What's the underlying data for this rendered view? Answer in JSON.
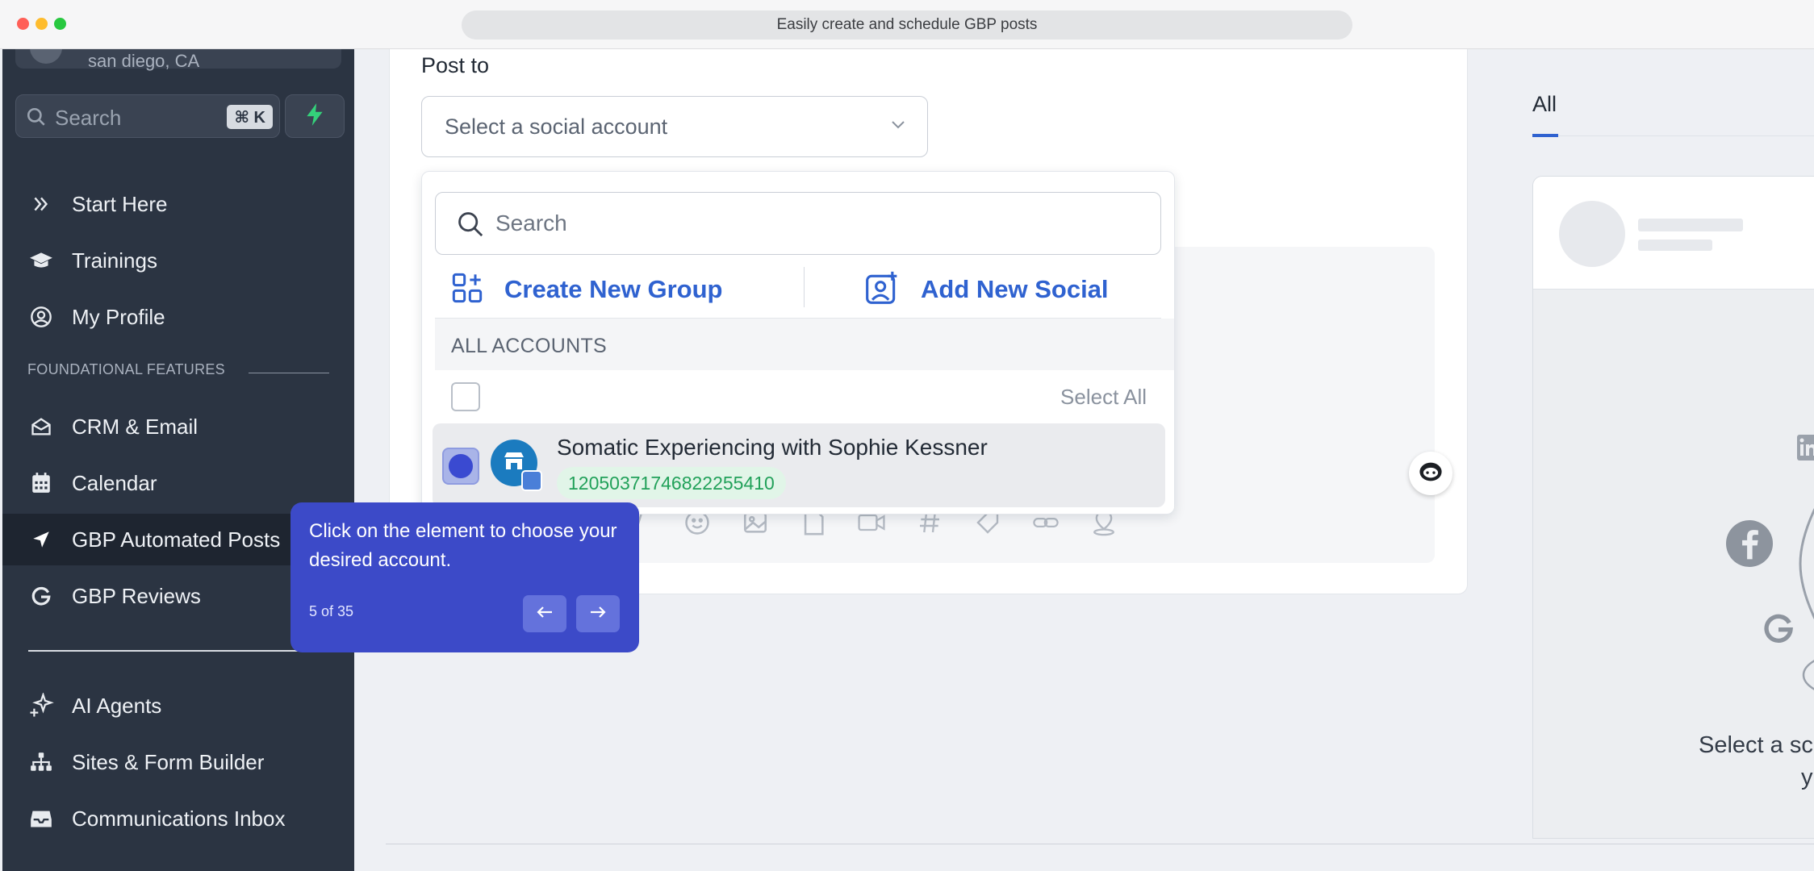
{
  "browser": {
    "tab_title": "Easily create and schedule GBP posts"
  },
  "sidebar": {
    "location": "san diego, CA",
    "search_label": "Search",
    "search_shortcut": "⌘ K",
    "items_top": [
      {
        "label": "Start Here",
        "icon": "chevrons-right-icon"
      },
      {
        "label": "Trainings",
        "icon": "graduation-cap-icon"
      },
      {
        "label": "My Profile",
        "icon": "user-circle-icon"
      }
    ],
    "section_title": "FOUNDATIONAL FEATURES",
    "items_foundational": [
      {
        "label": "CRM & Email",
        "icon": "mail-open-icon"
      },
      {
        "label": "Calendar",
        "icon": "calendar-icon"
      },
      {
        "label": "GBP Automated Posts",
        "icon": "send-arrow-icon"
      },
      {
        "label": "GBP Reviews",
        "icon": "google-g-icon"
      }
    ],
    "items_bottom": [
      {
        "label": "AI Agents",
        "icon": "sparkle-icon"
      },
      {
        "label": "Sites & Form Builder",
        "icon": "sitemap-icon"
      },
      {
        "label": "Communications Inbox",
        "icon": "inbox-icon"
      }
    ],
    "accent_color": "#2b3442"
  },
  "main": {
    "post_to_label": "Post to",
    "select_placeholder": "Select a social account"
  },
  "dropdown": {
    "search_placeholder": "Search",
    "create_group_label": "Create New Group",
    "add_social_label": "Add New Social",
    "section_label": "ALL ACCOUNTS",
    "select_all_label": "Select All",
    "account": {
      "name": "Somatic Experiencing with Sophie Kessner",
      "id": "12050371746822255410"
    },
    "accent_color": "#2f62d0"
  },
  "tooltip": {
    "text": "Click on the element to choose your desired account.",
    "step": "5 of 35",
    "color": "#3c4ac8"
  },
  "preview": {
    "tab_all": "All",
    "select_text": "Select a sc",
    "select_text2": "y"
  }
}
